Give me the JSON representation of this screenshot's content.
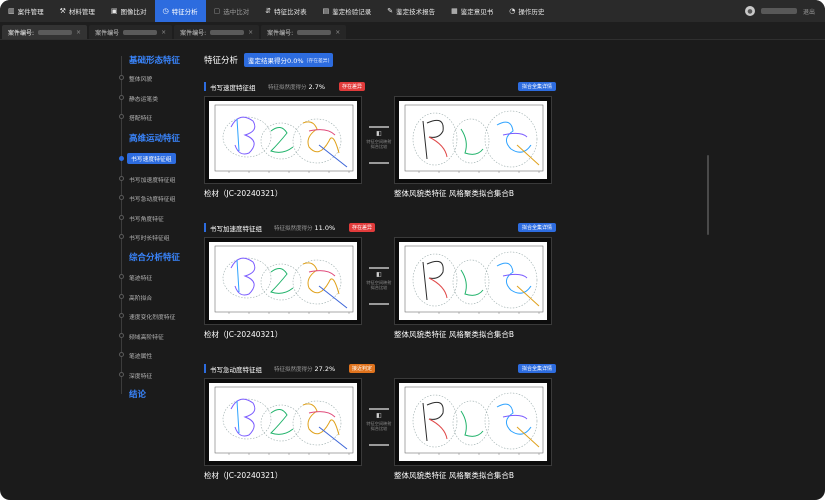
{
  "nav": {
    "items": [
      {
        "icon": "case-icon",
        "glyph": "▥",
        "label": "案件管理"
      },
      {
        "icon": "material-icon",
        "glyph": "⚒",
        "label": "材料管理"
      },
      {
        "icon": "image-compare-icon",
        "glyph": "▣",
        "label": "图像比对"
      },
      {
        "icon": "feature-analysis-icon",
        "glyph": "◷",
        "label": "特征分析"
      },
      {
        "icon": "selected-compare-icon",
        "glyph": "▢",
        "label": "选中比对"
      },
      {
        "icon": "feature-table-icon",
        "glyph": "⇵",
        "label": "特征比对表"
      },
      {
        "icon": "record-icon",
        "glyph": "▤",
        "label": "鉴定检验记录"
      },
      {
        "icon": "report-icon",
        "glyph": "✎",
        "label": "鉴定技术报告"
      },
      {
        "icon": "opinion-icon",
        "glyph": "▦",
        "label": "鉴定意见书"
      },
      {
        "icon": "history-icon",
        "glyph": "◔",
        "label": "操作历史"
      }
    ],
    "logout": "退出"
  },
  "tabs": [
    {
      "label": "案件编号:",
      "active": true
    },
    {
      "label": "案件编号",
      "active": false
    },
    {
      "label": "案件编号:",
      "active": false
    },
    {
      "label": "案件编号:",
      "active": false
    }
  ],
  "sidebar": {
    "sections": [
      {
        "title": "基础形态特征",
        "items": [
          "整体风貌",
          "静态运笔类",
          "搭配特征"
        ]
      },
      {
        "title": "高维运动特征",
        "items": [
          "书写速度特征组",
          "书写加速度特征组",
          "书写急动度特征组",
          "书写角度特征",
          "书写时长特征组"
        ]
      },
      {
        "title": "综合分析特征",
        "items": [
          "笔迹特征",
          "高阶拟合",
          "速度变化烈度特征",
          "频域高阶特征",
          "笔迹属性",
          "深度特征"
        ]
      },
      {
        "title": "结论",
        "items": []
      }
    ],
    "active_item": "书写速度特征组"
  },
  "main": {
    "title": "特征分析",
    "score_label": "鉴定结果得分0.0%",
    "score_note": "(存在差异)",
    "compare_label_top": "特征空间映射",
    "compare_label_bottom": "拟合比较",
    "sections": [
      {
        "name": "书写速度特征组",
        "meta_label": "特征拟然度得分",
        "score": "2.7%",
        "badge": "存在差异",
        "badge_color": "#e23b3b",
        "detail_button": "拟合全集详情",
        "left_caption": "检材（JC-20240321）",
        "right_caption": "整体风貌类特征 风格聚类拟合集合B"
      },
      {
        "name": "书写加速度特征组",
        "meta_label": "特征拟然度得分",
        "score": "11.0%",
        "badge": "存在差异",
        "badge_color": "#e23b3b",
        "detail_button": "拟合全集详情",
        "left_caption": "检材（JC-20240321）",
        "right_caption": "整体风貌类特征 风格聚类拟合集合B"
      },
      {
        "name": "书写急动度特征组",
        "meta_label": "特征拟然度得分",
        "score": "27.2%",
        "badge": "接近判定",
        "badge_color": "#e0731d",
        "detail_button": "拟合全集详情",
        "left_caption": "检材（JC-20240321）",
        "right_caption": "整体风貌类特征 风格聚类拟合集合B"
      }
    ]
  }
}
